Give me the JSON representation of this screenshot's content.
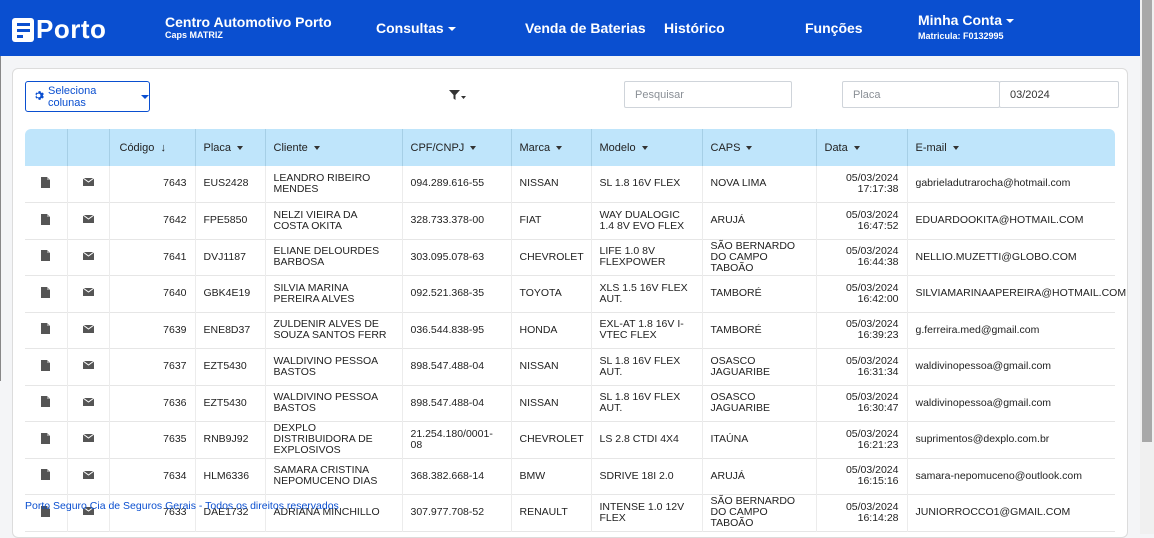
{
  "navbar": {
    "logo_text": "Porto",
    "brand_title": "Centro Automotivo Porto",
    "brand_sub": "Caps MATRIZ",
    "consultas": "Consultas",
    "venda_baterias": "Venda de Baterias",
    "historico": "Histórico",
    "funcoes": "Funções",
    "account_name": "Minha Conta",
    "account_sub": "Matricula: F0132995",
    "color": "#0a4fd0"
  },
  "toolbar": {
    "columns_button": "Seleciona colunas",
    "search_placeholder": "Pesquisar",
    "plate_placeholder": "Placa",
    "date_value": "03/2024"
  },
  "table": {
    "headers": {
      "codigo": "Código",
      "placa": "Placa",
      "cliente": "Cliente",
      "cpf": "CPF/CNPJ",
      "marca": "Marca",
      "modelo": "Modelo",
      "caps": "CAPS",
      "data": "Data",
      "email": "E-mail"
    },
    "rows": [
      {
        "codigo": "7643",
        "placa": "EUS2428",
        "cliente": "LEANDRO RIBEIRO MENDES",
        "cpf": "094.289.616-55",
        "marca": "NISSAN",
        "modelo": "SL 1.8 16V FLEX",
        "caps": "NOVA LIMA",
        "data": "05/03/2024",
        "hora": "17:17:38",
        "email": "gabrieladutrarocha@hotmail.com"
      },
      {
        "codigo": "7642",
        "placa": "FPE5850",
        "cliente": "NELZI VIEIRA DA COSTA OKITA",
        "cpf": "328.733.378-00",
        "marca": "FIAT",
        "modelo": "WAY DUALOGIC 1.4 8V EVO FLEX",
        "caps": "ARUJÁ",
        "data": "05/03/2024",
        "hora": "16:47:52",
        "email": "EDUARDOOKITA@HOTMAIL.COM"
      },
      {
        "codigo": "7641",
        "placa": "DVJ1187",
        "cliente": "ELIANE DELOURDES BARBOSA",
        "cpf": "303.095.078-63",
        "marca": "CHEVROLET",
        "modelo": "LIFE 1.0 8V FLEXPOWER",
        "caps": "SÃO BERNARDO DO CAMPO TABOÃO",
        "data": "05/03/2024",
        "hora": "16:44:38",
        "email": "NELLIO.MUZETTI@GLOBO.COM"
      },
      {
        "codigo": "7640",
        "placa": "GBK4E19",
        "cliente": "SILVIA MARINA PEREIRA ALVES",
        "cpf": "092.521.368-35",
        "marca": "TOYOTA",
        "modelo": "XLS 1.5 16V FLEX AUT.",
        "caps": "TAMBORÉ",
        "data": "05/03/2024",
        "hora": "16:42:00",
        "email": "SILVIAMARINAAPEREIRA@HOTMAIL.COM"
      },
      {
        "codigo": "7639",
        "placa": "ENE8D37",
        "cliente": "ZULDENIR ALVES DE SOUZA SANTOS FERR",
        "cpf": "036.544.838-95",
        "marca": "HONDA",
        "modelo": "EXL-AT 1.8 16V I-VTEC FLEX",
        "caps": "TAMBORÉ",
        "data": "05/03/2024",
        "hora": "16:39:23",
        "email": "g.ferreira.med@gmail.com"
      },
      {
        "codigo": "7637",
        "placa": "EZT5430",
        "cliente": "WALDIVINO PESSOA BASTOS",
        "cpf": "898.547.488-04",
        "marca": "NISSAN",
        "modelo": "SL 1.8 16V FLEX AUT.",
        "caps": "OSASCO JAGUARIBE",
        "data": "05/03/2024",
        "hora": "16:31:34",
        "email": "waldivinopessoa@gmail.com"
      },
      {
        "codigo": "7636",
        "placa": "EZT5430",
        "cliente": "WALDIVINO PESSOA BASTOS",
        "cpf": "898.547.488-04",
        "marca": "NISSAN",
        "modelo": "SL 1.8 16V FLEX AUT.",
        "caps": "OSASCO JAGUARIBE",
        "data": "05/03/2024",
        "hora": "16:30:47",
        "email": "waldivinopessoa@gmail.com"
      },
      {
        "codigo": "7635",
        "placa": "RNB9J92",
        "cliente": "DEXPLO DISTRIBUIDORA DE EXPLOSIVOS",
        "cpf": "21.254.180/0001-08",
        "marca": "CHEVROLET",
        "modelo": "LS 2.8 CTDI 4X4",
        "caps": "ITAÚNA",
        "data": "05/03/2024",
        "hora": "16:21:23",
        "email": "suprimentos@dexplo.com.br"
      },
      {
        "codigo": "7634",
        "placa": "HLM6336",
        "cliente": "SAMARA CRISTINA NEPOMUCENO DIAS",
        "cpf": "368.382.668-14",
        "marca": "BMW",
        "modelo": "SDRIVE 18I 2.0",
        "caps": "ARUJÁ",
        "data": "05/03/2024",
        "hora": "16:15:16",
        "email": "samara-nepomuceno@outlook.com"
      },
      {
        "codigo": "7633",
        "placa": "DAE1732",
        "cliente": "ADRIANA MINCHILLO",
        "cpf": "307.977.708-52",
        "marca": "RENAULT",
        "modelo": "INTENSE 1.0 12V FLEX",
        "caps": "SÃO BERNARDO DO CAMPO TABOÃO",
        "data": "05/03/2024",
        "hora": "16:14:28",
        "email": "JUNIORROCCO1@GMAIL.COM"
      }
    ]
  },
  "footer": {
    "text": "Porto Seguro Cia de Seguros Gerais - Todos os direitos reservados"
  }
}
